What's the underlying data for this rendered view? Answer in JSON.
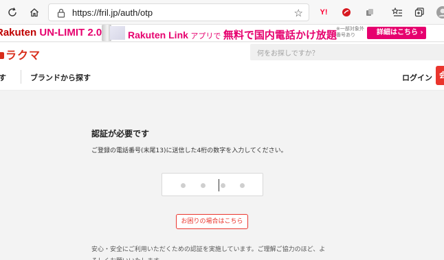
{
  "browser": {
    "url": "https://fril.jp/auth/otp",
    "ext_y_label": "Y!"
  },
  "ad_banner": {
    "brand_rakuten": "Rakuten",
    "brand_plan": " UN-LIMIT 2.0",
    "link_app": "Rakuten Link",
    "link_app_suffix": " アプリで ",
    "headline": "無料で国内電話かけ放題",
    "note_line1": "※一部対象外",
    "note_line2": "番号あり",
    "cta": "詳細はこちら ›"
  },
  "site": {
    "logo": "ラクマ",
    "search_placeholder": "何をお探しですか？",
    "nav_category": "す",
    "nav_brand": "ブランドから探す",
    "login": "ログイン",
    "register": "会"
  },
  "auth": {
    "title": "認証が必要です",
    "description": "ご登録の電話番号(末尾13)に送信した4桁の数字を入力してください。",
    "help_button": "お困りの場合はこちら",
    "notice": "安心・安全にご利用いただくための認証を実施しています。ご理解ご協力のほど、よろしくお願いいたします。"
  },
  "colors": {
    "brand_red": "#ea352d",
    "ad_pink": "#e6006e",
    "rakuten_red": "#bf0000"
  }
}
